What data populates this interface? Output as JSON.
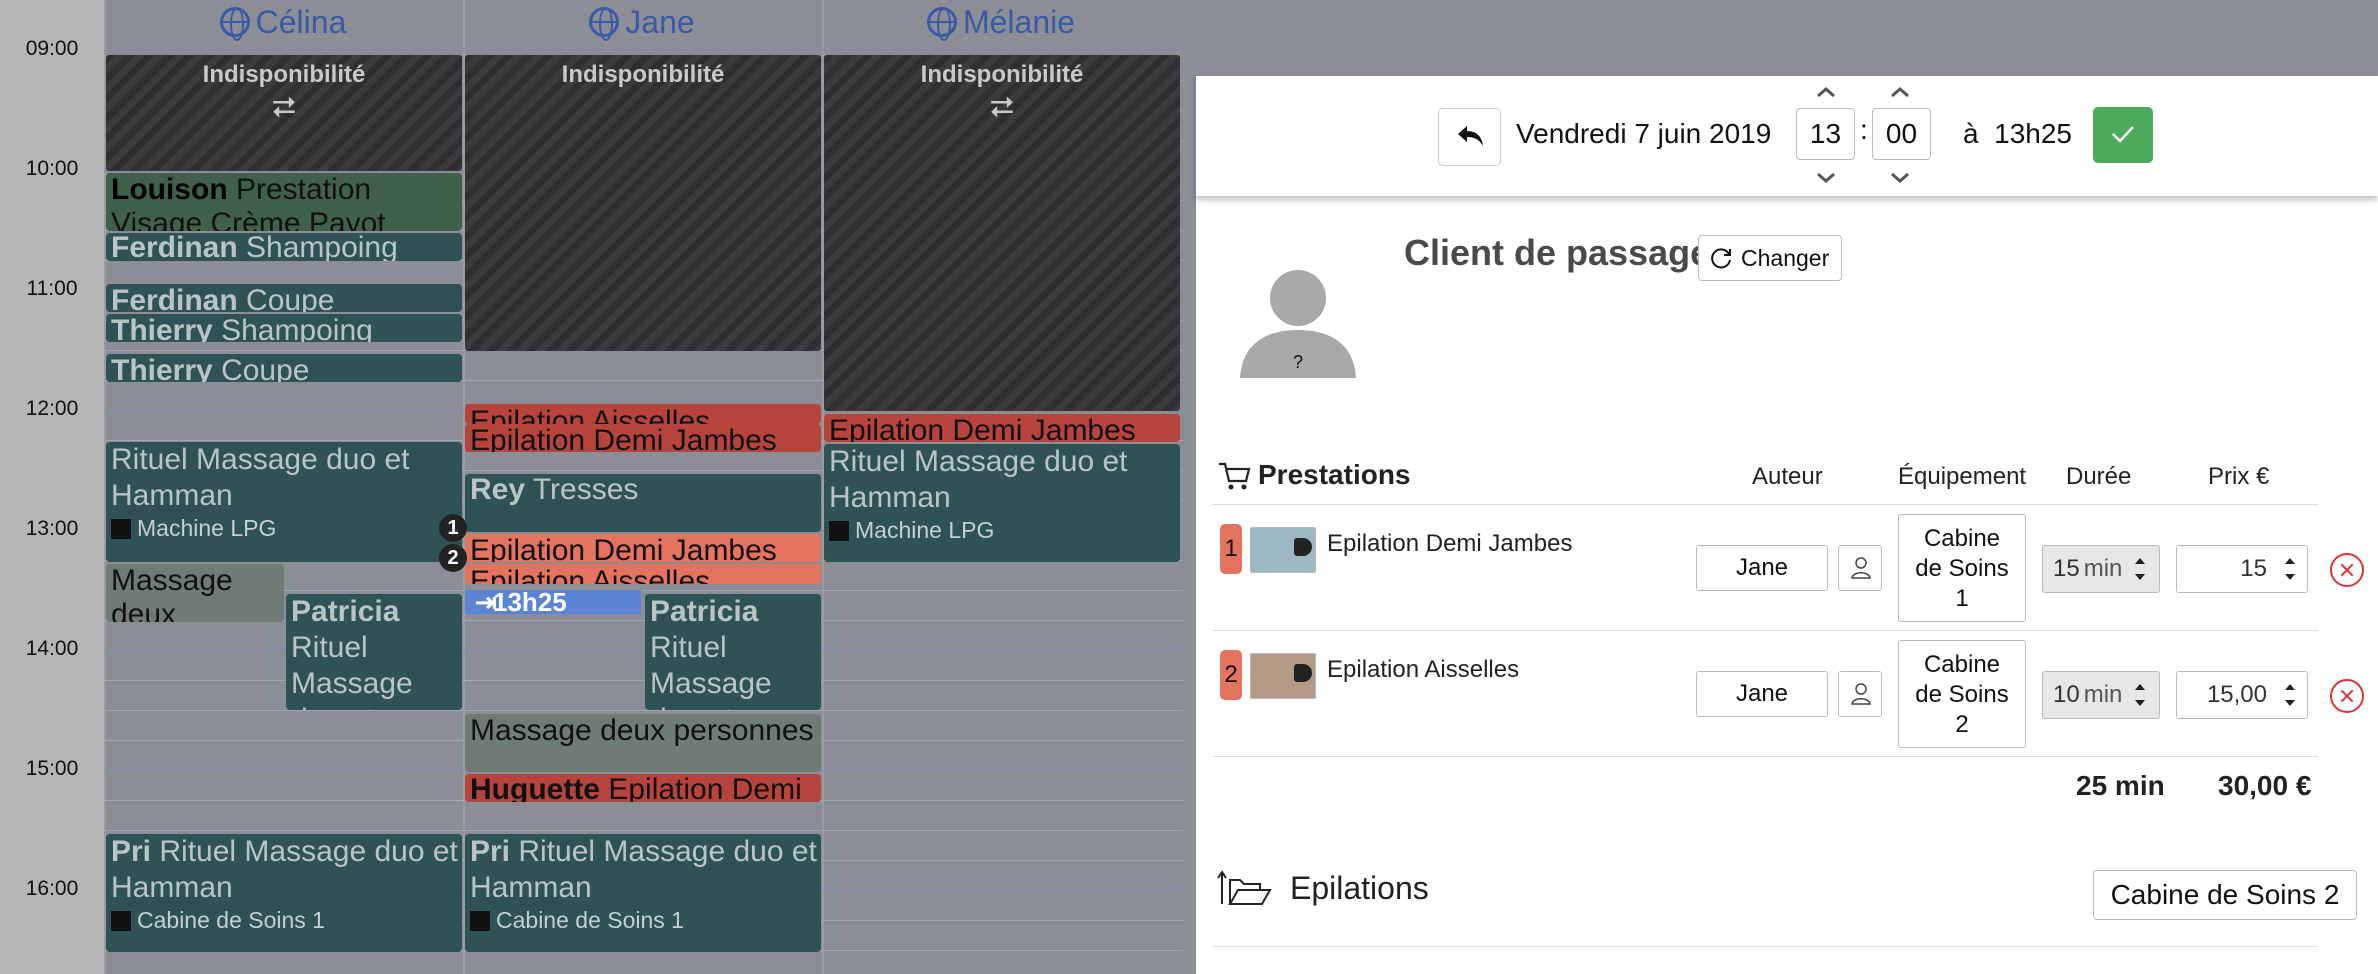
{
  "calendar": {
    "hours": [
      "09:00",
      "10:00",
      "11:00",
      "12:00",
      "13:00",
      "14:00",
      "15:00",
      "16:00"
    ],
    "staff": [
      "Célina",
      "Jane",
      "Mélanie"
    ],
    "unavailable_label": "Indisponibilité",
    "events": {
      "louison_name": "Louison",
      "louison_text": "Prestation Visage Crème Payot",
      "ferd1_name": "Ferdinan",
      "ferd1_text": "Shampoing",
      "ferd2_name": "Ferdinan",
      "ferd2_text": "Coupe",
      "thierry1_name": "Thierry",
      "thierry1_text": "Shampoing",
      "thierry2_name": "Thierry",
      "thierry2_text": "Coupe",
      "rituel_celina": "Rituel Massage duo et Hamman",
      "rituel_celina_sub": "Machine LPG",
      "massage_deux_celina": "Massage deux personnes",
      "patricia_celina_name": "Patricia",
      "patricia_celina_text": "Rituel Massage duo et Hamman",
      "pri_celina_name": "Pri",
      "pri_celina_text": "Rituel Massage duo et Hamman",
      "pri_celina_sub": "Cabine de Soins 1",
      "jane_ep_ais1": "Epilation Aisselles",
      "jane_ep_dj1": "Epilation Demi Jambes",
      "rey_name": "Rey",
      "rey_text": "Tresses",
      "jane_ep_dj2": "Epilation Demi Jambes",
      "jane_ep_ais2": "Epilation Aisselles",
      "now_label": "13h25",
      "patricia_jane_name": "Patricia",
      "patricia_jane_text": "Rituel Massage duo et Hamman",
      "massage_deux_jane": "Massage deux personnes",
      "huguette_name": "Huguette",
      "huguette_text": "Epilation Demi Jambes",
      "pri_jane_name": "Pri",
      "pri_jane_text": "Rituel Massage duo et Hamman",
      "pri_jane_sub": "Cabine de Soins 1",
      "mel_ep_dj": "Epilation Demi Jambes",
      "rituel_mel": "Rituel Massage duo et Hamman",
      "rituel_mel_sub": "Machine LPG",
      "num1": "1",
      "num2": "2"
    }
  },
  "panel": {
    "date": "Vendredi 7 juin 2019",
    "hour": "13",
    "minute": "00",
    "colon": ":",
    "end_label": "à",
    "end_time": "13h25",
    "client_name": "Client de passage",
    "change_label": "Changer",
    "avatar_mark": "?",
    "table": {
      "title": "Prestations",
      "col_author": "Auteur",
      "col_equipment": "Équipement",
      "col_duration": "Durée",
      "col_price": "Prix €"
    },
    "rows": [
      {
        "index": "1",
        "name": "Epilation Demi Jambes",
        "author": "Jane",
        "equip_lines": [
          "Cabine",
          "de Soins",
          "1"
        ],
        "duration": "15",
        "unit": "min",
        "price": "15"
      },
      {
        "index": "2",
        "name": "Epilation Aisselles",
        "author": "Jane",
        "equip_lines": [
          "Cabine",
          "de Soins",
          "2"
        ],
        "duration": "10",
        "unit": "min",
        "price": "15,00"
      }
    ],
    "total_duration": "25 min",
    "total_price": "30,00 €",
    "category": "Epilations",
    "category_button": "Cabine de Soins 2"
  },
  "colors": {
    "accent_green": "#4caa5a",
    "event_dark": "#2f5355",
    "event_salmon": "#e4735f",
    "delete_red": "#dd3333",
    "link_blue": "#3a5aa8"
  }
}
